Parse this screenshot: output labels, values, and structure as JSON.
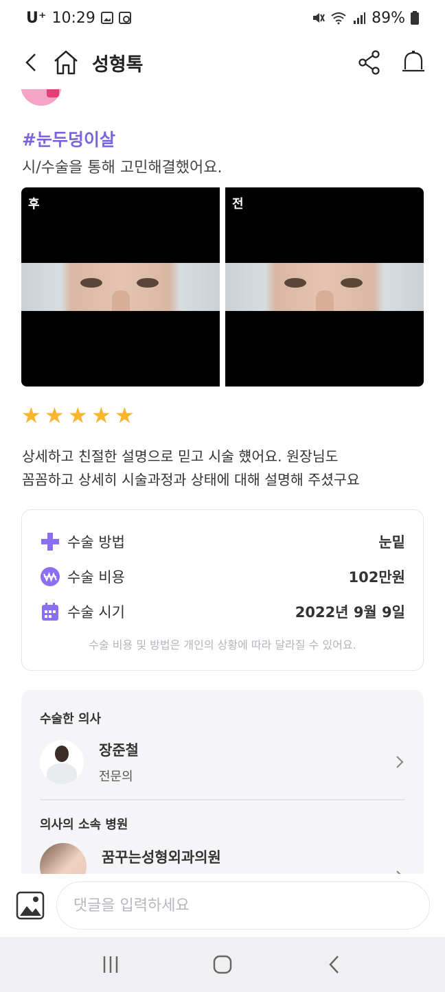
{
  "status_bar": {
    "carrier": "U⁺",
    "time": "10:29",
    "battery": "89%",
    "icons": [
      "image-icon",
      "clock-icon",
      "mute-icon",
      "wifi-icon",
      "signal-icon",
      "battery-icon"
    ]
  },
  "header": {
    "title": "성형톡",
    "icons": [
      "back-icon",
      "home-icon",
      "share-icon",
      "notification-bell-icon"
    ]
  },
  "post": {
    "hashtag": "#눈두덩이살",
    "subtitle": "시/수술을 통해 고민해결했어요.",
    "photos": [
      {
        "label": "후"
      },
      {
        "label": "전"
      }
    ],
    "rating": 5,
    "review_lines": [
      "상세하고 친절한 설명으로 믿고 시술 헀어요. 원장님도",
      "꼼꼼하고 상세히 시술과정과 상태에 대해 설명해 주셨구요"
    ]
  },
  "info": {
    "method_label": "수술 방법",
    "method_value": "눈밑",
    "cost_label": "수술 비용",
    "cost_value": "102만원",
    "date_label": "수술 시기",
    "date_value": "2022년 9월 9일",
    "note": "수술 비용 및 방법은 개인의 상황에 따라 달라질 수 있어요.",
    "accent": "#8a6ff0"
  },
  "doctor": {
    "section_title": "수술한 의사",
    "name": "장준철",
    "role": "전문의"
  },
  "hospital": {
    "section_title": "의사의 소속 병원",
    "name": "꿈꾸는성형외과의원"
  },
  "comment": {
    "placeholder": "댓글을 입력하세요"
  },
  "colors": {
    "brand": "#7b63e0",
    "star": "#f9b52b"
  }
}
